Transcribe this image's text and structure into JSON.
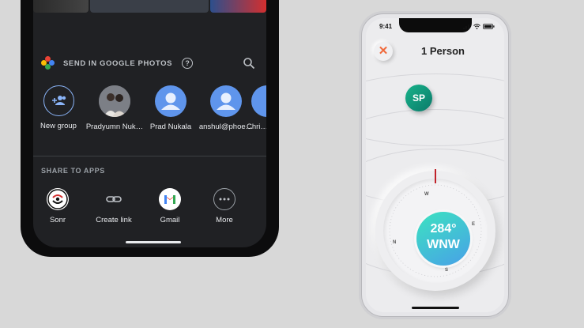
{
  "left_phone": {
    "share_section_title": "SEND IN GOOGLE PHOTOS",
    "contacts": [
      {
        "label": "New group",
        "kind": "new-group"
      },
      {
        "label": "Pradyumn Nuk…",
        "kind": "photo"
      },
      {
        "label": "Prad Nukala",
        "kind": "default"
      },
      {
        "label": "anshul@phoe…",
        "kind": "default"
      },
      {
        "label": "Chri…",
        "kind": "default"
      }
    ],
    "apps_section_title": "SHARE TO APPS",
    "apps": [
      {
        "label": "Sonr",
        "icon": "sonr-icon"
      },
      {
        "label": "Create link",
        "icon": "link-icon"
      },
      {
        "label": "Gmail",
        "icon": "gmail-icon"
      },
      {
        "label": "More",
        "icon": "more-icon"
      }
    ]
  },
  "right_phone": {
    "status_time": "9:41",
    "title": "1 Person",
    "peer_initials": "SP",
    "compass_heading": "284°",
    "compass_direction": "WNW",
    "compass_marks": {
      "n": "N",
      "e": "E",
      "s": "S",
      "w": "W"
    },
    "colors": {
      "accent_close": "#f06a3c",
      "peer_badge": "#0b7a6a",
      "dial_start": "#3ce3c0",
      "dial_end": "#48a0e8",
      "needle": "#c0222a"
    }
  }
}
